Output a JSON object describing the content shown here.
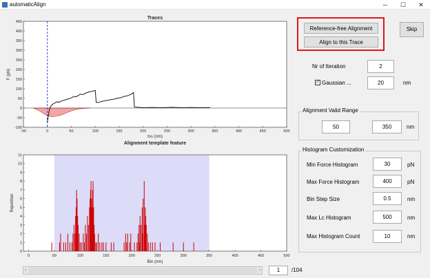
{
  "window": {
    "title": "automaticAlign",
    "minimize": "─",
    "maximize": "☐",
    "close": "✕"
  },
  "traces_plot": {
    "title": "Traces",
    "xlabel": "tss (nm)",
    "ylabel": "F (pN)",
    "xlim": [
      -50,
      500
    ],
    "ylim": [
      -100,
      450
    ],
    "x_ticks": [
      "-50",
      "0",
      "50",
      "100",
      "150",
      "200",
      "250",
      "300",
      "350",
      "400",
      "450",
      "500"
    ],
    "y_ticks": [
      "-100",
      "-50",
      "0",
      "50",
      "100",
      "150",
      "200",
      "250",
      "300",
      "350",
      "400",
      "450"
    ],
    "reference_line_x": 0,
    "colors": {
      "trace": "#000000",
      "template": "#f4a6a6",
      "template_edge": "#c0392b",
      "reference": "#3b3bdc"
    },
    "trace_points": [
      [
        0,
        -75
      ],
      [
        2,
        -40
      ],
      [
        4,
        -10
      ],
      [
        6,
        5
      ],
      [
        10,
        18
      ],
      [
        15,
        25
      ],
      [
        20,
        32
      ],
      [
        25,
        30
      ],
      [
        30,
        38
      ],
      [
        35,
        40
      ],
      [
        40,
        45
      ],
      [
        45,
        48
      ],
      [
        50,
        52
      ],
      [
        55,
        60
      ],
      [
        60,
        58
      ],
      [
        65,
        66
      ],
      [
        70,
        72
      ],
      [
        75,
        70
      ],
      [
        80,
        78
      ],
      [
        85,
        82
      ],
      [
        90,
        85
      ],
      [
        95,
        88
      ],
      [
        100,
        92
      ],
      [
        102,
        30
      ],
      [
        105,
        28
      ],
      [
        110,
        32
      ],
      [
        115,
        35
      ],
      [
        120,
        38
      ],
      [
        125,
        40
      ],
      [
        130,
        42
      ],
      [
        135,
        45
      ],
      [
        140,
        46
      ],
      [
        145,
        50
      ],
      [
        150,
        52
      ],
      [
        155,
        55
      ],
      [
        160,
        60
      ],
      [
        165,
        62
      ],
      [
        170,
        66
      ],
      [
        175,
        72
      ],
      [
        180,
        80
      ],
      [
        182,
        5
      ],
      [
        190,
        4
      ],
      [
        200,
        2
      ],
      [
        220,
        3
      ],
      [
        240,
        2
      ],
      [
        260,
        4
      ],
      [
        280,
        2
      ],
      [
        300,
        3
      ],
      [
        320,
        2
      ],
      [
        340,
        3
      ]
    ],
    "template_points": [
      [
        -30,
        0
      ],
      [
        -20,
        -10
      ],
      [
        -10,
        -25
      ],
      [
        0,
        -40
      ],
      [
        10,
        -45
      ],
      [
        20,
        -42
      ],
      [
        30,
        -35
      ],
      [
        40,
        -25
      ],
      [
        50,
        -15
      ],
      [
        60,
        -7
      ],
      [
        75,
        -2
      ],
      [
        90,
        0
      ]
    ]
  },
  "histogram_plot": {
    "title": "Alignment template feature",
    "xlabel": "Bin (nm)",
    "ylabel": "Repetition",
    "xlim": [
      -10,
      500
    ],
    "ylim": [
      0,
      11
    ],
    "x_ticks": [
      "0",
      "50",
      "100",
      "150",
      "200",
      "250",
      "300",
      "350",
      "400",
      "450",
      "500"
    ],
    "y_ticks": [
      "0",
      "1",
      "2",
      "3",
      "4",
      "5",
      "6",
      "7",
      "8",
      "9",
      "10",
      "11"
    ],
    "valid_range": [
      50,
      350
    ],
    "bin_step": 0.5,
    "colors": {
      "bars": "#cc0000",
      "range_fill": "#dcdcf8"
    },
    "bars": [
      [
        45,
        1
      ],
      [
        60,
        1
      ],
      [
        62,
        2
      ],
      [
        68,
        1
      ],
      [
        72,
        1
      ],
      [
        76,
        2
      ],
      [
        80,
        1
      ],
      [
        84,
        1
      ],
      [
        86,
        2
      ],
      [
        88,
        3
      ],
      [
        90,
        2
      ],
      [
        91,
        4
      ],
      [
        92,
        5
      ],
      [
        93,
        7
      ],
      [
        94,
        6
      ],
      [
        95,
        4
      ],
      [
        96,
        3
      ],
      [
        98,
        2
      ],
      [
        100,
        1
      ],
      [
        103,
        1
      ],
      [
        106,
        2
      ],
      [
        108,
        1
      ],
      [
        110,
        3
      ],
      [
        112,
        2
      ],
      [
        114,
        4
      ],
      [
        116,
        3
      ],
      [
        118,
        5
      ],
      [
        119,
        6
      ],
      [
        120,
        7
      ],
      [
        121,
        8
      ],
      [
        122,
        6
      ],
      [
        123,
        5
      ],
      [
        124,
        7
      ],
      [
        125,
        8
      ],
      [
        126,
        5
      ],
      [
        127,
        3
      ],
      [
        128,
        2
      ],
      [
        130,
        1
      ],
      [
        132,
        1
      ],
      [
        135,
        2
      ],
      [
        138,
        1
      ],
      [
        142,
        1
      ],
      [
        145,
        1
      ],
      [
        150,
        1
      ],
      [
        160,
        1
      ],
      [
        165,
        1
      ],
      [
        185,
        1
      ],
      [
        188,
        2
      ],
      [
        190,
        1
      ],
      [
        192,
        2
      ],
      [
        196,
        1
      ],
      [
        198,
        2
      ],
      [
        205,
        1
      ],
      [
        210,
        1
      ],
      [
        212,
        2
      ],
      [
        214,
        3
      ],
      [
        215,
        1
      ],
      [
        216,
        4
      ],
      [
        218,
        3
      ],
      [
        220,
        5
      ],
      [
        221,
        2
      ],
      [
        222,
        6
      ],
      [
        224,
        8
      ],
      [
        225,
        3
      ],
      [
        226,
        5
      ],
      [
        227,
        4
      ],
      [
        228,
        3
      ],
      [
        230,
        2
      ],
      [
        232,
        1
      ],
      [
        236,
        1
      ],
      [
        240,
        1
      ],
      [
        245,
        1
      ],
      [
        255,
        1
      ],
      [
        280,
        1
      ],
      [
        300,
        1
      ],
      [
        320,
        1
      ]
    ]
  },
  "controls": {
    "ref_free_button": "Reference-free Alignment",
    "align_trace_button": "Align to this Trace",
    "skip_button": "Skip",
    "iteration_label": "Nr of Iteration",
    "iteration_value": "2",
    "gaussian_checked": true,
    "gaussian_check_mark": "✓",
    "gaussian_label": "Gaussian ...",
    "gaussian_value": "20",
    "gaussian_unit": "nm"
  },
  "valid_range_panel": {
    "title": "Alignment Valid Range",
    "min_value": "50",
    "max_value": "350",
    "unit": "nm"
  },
  "histogram_panel": {
    "title": "Histogram Customization",
    "rows": [
      {
        "label": "Min Force Histogram",
        "value": "30",
        "unit": "pN"
      },
      {
        "label": "Max Force Histogram",
        "value": "400",
        "unit": "pN"
      },
      {
        "label": "Bin Step Size",
        "value": "0.5",
        "unit": "nm"
      },
      {
        "label": "Max Lc Histogram",
        "value": "500",
        "unit": "nm"
      },
      {
        "label": "Max Histogram Count",
        "value": "10",
        "unit": "nm"
      }
    ]
  },
  "navigation": {
    "left_arrow": "‹",
    "right_arrow": "›",
    "current_page": "1",
    "total_pages": "/104"
  }
}
